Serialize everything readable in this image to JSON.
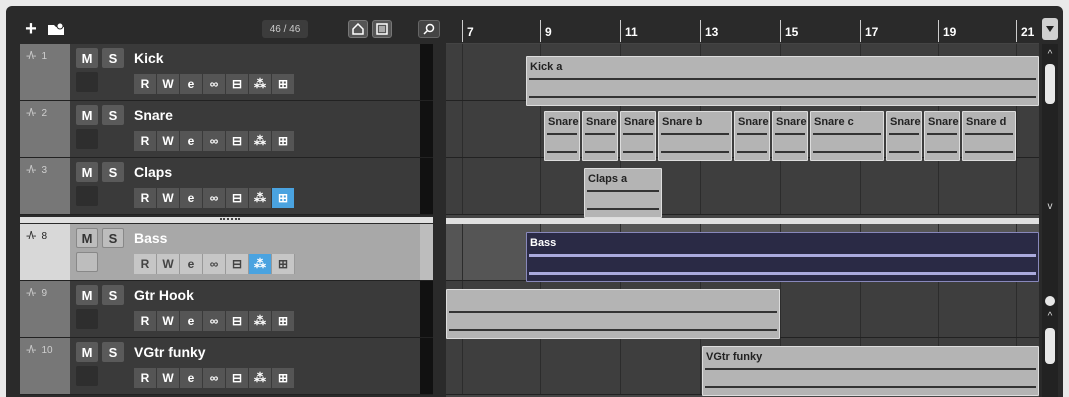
{
  "toolbar": {
    "add_icon": "+",
    "track_count": "46 / 46"
  },
  "tracks": [
    {
      "num": "1",
      "name": "Kick",
      "mute": "M",
      "solo": "S",
      "read": "R",
      "write": "W",
      "selected": false
    },
    {
      "num": "2",
      "name": "Snare",
      "mute": "M",
      "solo": "S",
      "read": "R",
      "write": "W",
      "selected": false
    },
    {
      "num": "3",
      "name": "Claps",
      "mute": "M",
      "solo": "S",
      "read": "R",
      "write": "W",
      "selected": false
    },
    {
      "num": "8",
      "name": "Bass",
      "mute": "M",
      "solo": "S",
      "read": "R",
      "write": "W",
      "selected": true
    },
    {
      "num": "9",
      "name": "Gtr Hook",
      "mute": "M",
      "solo": "S",
      "read": "R",
      "write": "W",
      "selected": false
    },
    {
      "num": "10",
      "name": "VGtr funky",
      "mute": "M",
      "solo": "S",
      "read": "R",
      "write": "W",
      "selected": false
    }
  ],
  "ruler": [
    "7",
    "9",
    "11",
    "13",
    "15",
    "17",
    "19",
    "21"
  ],
  "clips": {
    "kick": "Kick a",
    "snares": [
      "Snare",
      "Snare",
      "Snare",
      "Snare b",
      "Snare",
      "Snare",
      "Snare c",
      "Snare",
      "Snare",
      "Snare d"
    ],
    "claps": "Claps a",
    "bass": "Bass",
    "vgtr": "VGtr funky"
  },
  "colors": {
    "accent": "#4aa3e0",
    "selected_track": "#a8a8a8",
    "clip": "#b4b4b4"
  }
}
